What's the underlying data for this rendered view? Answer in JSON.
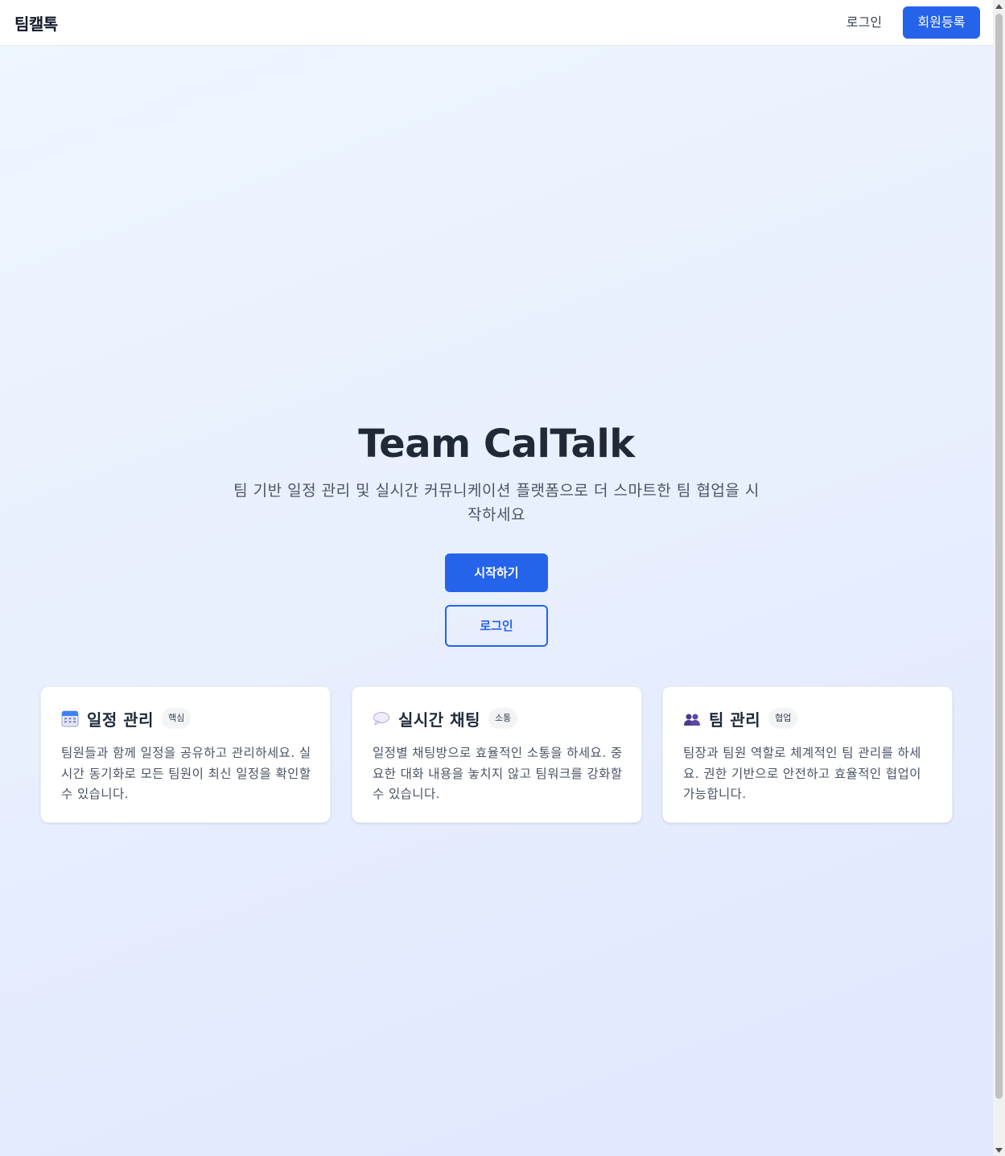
{
  "header": {
    "brand": "팀캘톡",
    "login_label": "로그인",
    "register_label": "회원등록"
  },
  "hero": {
    "title": "Team CalTalk",
    "subtitle": "팀 기반 일정 관리 및 실시간 커뮤니케이션 플랫폼으로 더 스마트한 팀 협업을 시작하세요",
    "start_label": "시작하기",
    "login_label": "로그인"
  },
  "features": [
    {
      "icon": "calendar-icon",
      "title": "일정 관리",
      "badge": "핵심",
      "description": "팀원들과 함께 일정을 공유하고 관리하세요. 실시간 동기화로 모든 팀원이 최신 일정을 확인할 수 있습니다."
    },
    {
      "icon": "speech-bubble-icon",
      "title": "실시간 채팅",
      "badge": "소통",
      "description": "일정별 채팅방으로 효율적인 소통을 하세요. 중요한 대화 내용을 놓치지 않고 팀워크를 강화할 수 있습니다."
    },
    {
      "icon": "team-icon",
      "title": "팀 관리",
      "badge": "협업",
      "description": "팀장과 팀원 역할로 체계적인 팀 관리를 하세요. 권한 기반으로 안전하고 효율적인 협업이 가능합니다."
    }
  ],
  "colors": {
    "primary": "#2563eb",
    "text_dark": "#1f2937",
    "text_muted": "#4b5563",
    "background_start": "#eff6ff",
    "background_end": "#e0e7ff"
  }
}
